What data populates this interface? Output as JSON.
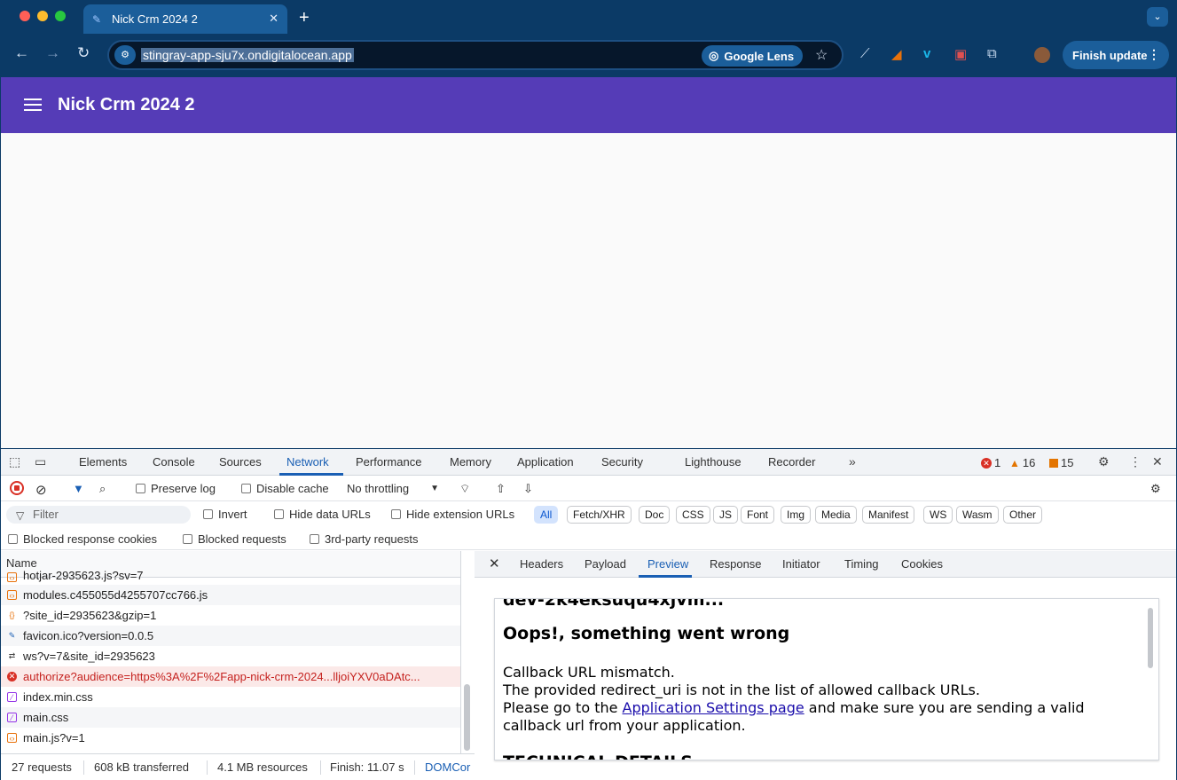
{
  "browser": {
    "tab_title": "Nick Crm 2024 2",
    "url": "stingray-app-sju7x.ondigitalocean.app",
    "lens_label": "Google Lens",
    "finish_update": "Finish update"
  },
  "app": {
    "title": "Nick Crm 2024 2",
    "appbar_color": "#553cb7"
  },
  "devtools": {
    "tabs": [
      "Elements",
      "Console",
      "Sources",
      "Network",
      "Performance",
      "Memory",
      "Application",
      "Security",
      "Lighthouse",
      "Recorder"
    ],
    "active_tab": "Network",
    "errors": "1",
    "warnings": "16",
    "issues": "15",
    "toolbar": {
      "preserve_log": "Preserve log",
      "disable_cache": "Disable cache",
      "throttling": "No throttling"
    },
    "filter": {
      "placeholder": "Filter",
      "invert": "Invert",
      "hide_data_urls": "Hide data URLs",
      "hide_extension_urls": "Hide extension URLs",
      "types": [
        "All",
        "Fetch/XHR",
        "Doc",
        "CSS",
        "JS",
        "Font",
        "Img",
        "Media",
        "Manifest",
        "WS",
        "Wasm",
        "Other"
      ]
    },
    "row3": {
      "blocked_cookies": "Blocked response cookies",
      "blocked_requests": "Blocked requests",
      "third_party": "3rd-party requests"
    },
    "list_header": "Name",
    "requests": [
      {
        "name": "hotjar-2935623.js?sv=7",
        "icon": "js"
      },
      {
        "name": "modules.c455055d4255707cc766.js",
        "icon": "js"
      },
      {
        "name": "?site_id=2935623&gzip=1",
        "icon": "xhr"
      },
      {
        "name": "favicon.ico?version=0.0.5",
        "icon": "img"
      },
      {
        "name": "ws?v=7&site_id=2935623",
        "icon": "ws"
      },
      {
        "name": "authorize?audience=https%3A%2F%2Fapp-nick-crm-2024...lljoiYXV0aDAtc...",
        "icon": "error"
      },
      {
        "name": "index.min.css",
        "icon": "css"
      },
      {
        "name": "main.css",
        "icon": "css"
      },
      {
        "name": "main.js?v=1",
        "icon": "js"
      }
    ],
    "status": {
      "requests": "27 requests",
      "transferred": "608 kB transferred",
      "resources": "4.1 MB resources",
      "finish": "Finish: 11.07 s",
      "domcontent": "DOMCor"
    },
    "detail_tabs": [
      "Headers",
      "Payload",
      "Preview",
      "Response",
      "Initiator",
      "Timing",
      "Cookies"
    ],
    "active_detail_tab": "Preview",
    "preview": {
      "cut_top": "dev-2k4eksuqu4xjvm...",
      "heading": "Oops!, something went wrong",
      "line1": "Callback URL mismatch.",
      "line2": "The provided redirect_uri is not in the list of allowed callback URLs.",
      "line3_pre": "Please go to the ",
      "line3_link": "Application Settings page",
      "line3_post": " and make sure you are sending a valid",
      "line4": "callback url from your application.",
      "cut_bottom": "TECHNICAL DETAILS"
    }
  }
}
